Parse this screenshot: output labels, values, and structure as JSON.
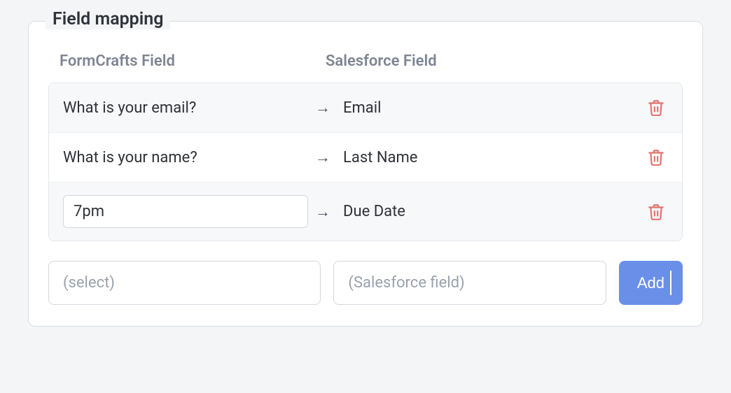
{
  "section": {
    "title": "Field mapping",
    "headers": {
      "left": "FormCrafts Field",
      "right": "Salesforce Field"
    }
  },
  "mappings": [
    {
      "source": "What is your email?",
      "arrow": "→",
      "target": "Email",
      "source_is_input": false
    },
    {
      "source": "What is your name?",
      "arrow": "→",
      "target": "Last Name",
      "source_is_input": false
    },
    {
      "source": "7pm",
      "arrow": "→",
      "target": "Due Date",
      "source_is_input": true
    }
  ],
  "new_mapping": {
    "source_placeholder": "(select)",
    "target_placeholder": "(Salesforce field)",
    "add_label": "Add"
  }
}
